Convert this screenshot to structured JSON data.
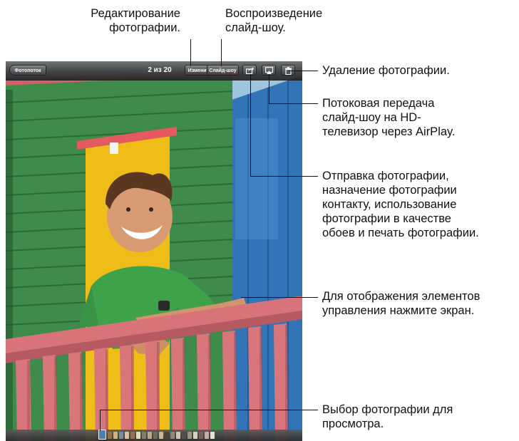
{
  "device": {
    "topbar": {
      "back_button": "Фотопоток",
      "counter": "2 из 20",
      "edit_button": "Изменить",
      "slideshow_button": "Слайд-шоу",
      "icons": [
        "share-icon",
        "airplay-icon",
        "trash-icon"
      ]
    },
    "bottombar": {
      "thumbnail_strip": "photo-thumbnail-scrubber"
    }
  },
  "callouts": {
    "edit": [
      "Редактирование",
      "фотографии."
    ],
    "slideshow": [
      "Воспроизведение",
      "слайд-шоу."
    ],
    "delete": [
      "Удаление фотографии."
    ],
    "airplay": [
      "Потоковая передача",
      "слайд-шоу на HD-",
      "телевизор через AirPlay."
    ],
    "share": [
      "Отправка фотографии,",
      "назначение фотографии",
      "контакту, использование",
      "фотографии в качестве",
      "обоев и печать фотографии."
    ],
    "tap": [
      "Для отображения элементов",
      "управления нажмите экран."
    ],
    "select": [
      "Выбор фотографии для",
      "просмотра."
    ]
  },
  "colors": {
    "wall_blue": "#2f6fb0",
    "shed_green": "#3a8a4a",
    "door_yellow": "#f0c21a",
    "railing_pink": "#d96f73",
    "bar_gray": "#3c3c3c"
  }
}
